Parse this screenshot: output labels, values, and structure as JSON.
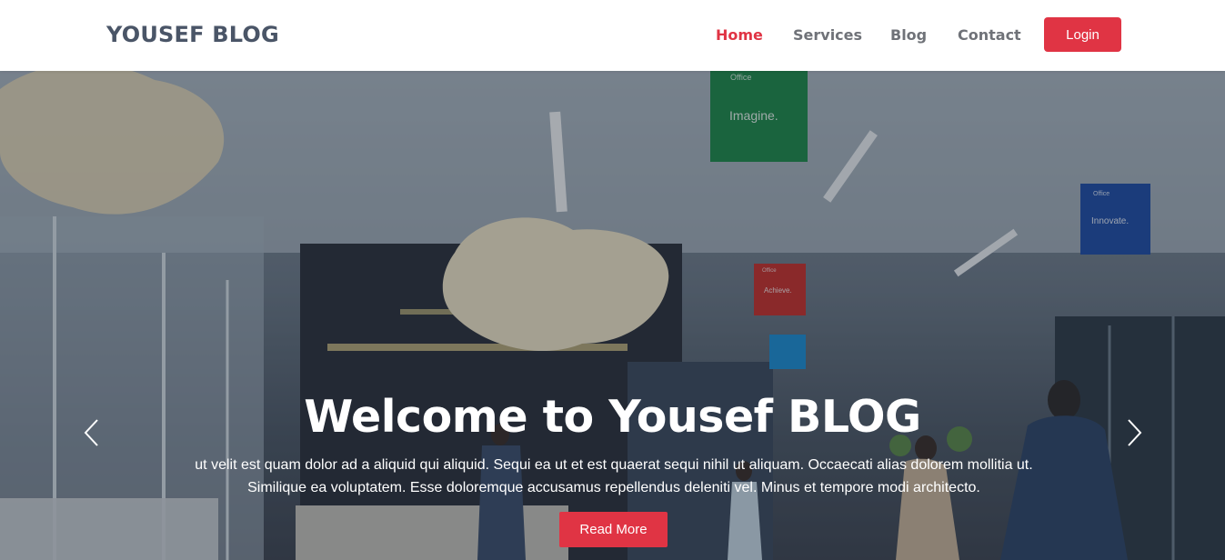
{
  "brand": {
    "name": "YOUSEF BLOG"
  },
  "nav": {
    "items": [
      {
        "label": "Home",
        "active": true
      },
      {
        "label": "Services",
        "active": false
      },
      {
        "label": "Blog",
        "active": false
      },
      {
        "label": "Contact",
        "active": false
      }
    ],
    "login_label": "Login"
  },
  "hero": {
    "title": "Welcome to Yousef BLOG",
    "text": "ut velit est quam dolor ad a aliquid qui aliquid. Sequi ea ut et est quaerat sequi nihil ut aliquam. Occaecati alias dolorem mollitia ut. Similique ea voluptatem. Esse doloremque accusamus repellendus deleniti vel. Minus et tempore modi architecto.",
    "button_label": "Read More",
    "prev_icon": "chevron-left-icon",
    "next_icon": "chevron-right-icon",
    "signs": [
      {
        "text": "Imagine.",
        "brand": "Office",
        "color": "#1e8a4a"
      },
      {
        "text": "Innovate.",
        "brand": "Office",
        "color": "#1f4ea8"
      },
      {
        "text": "Achieve.",
        "brand": "Office",
        "color": "#c9302c"
      }
    ]
  },
  "colors": {
    "accent": "#e03444",
    "brand_text": "#4a5567",
    "nav_text": "#6f7278"
  }
}
